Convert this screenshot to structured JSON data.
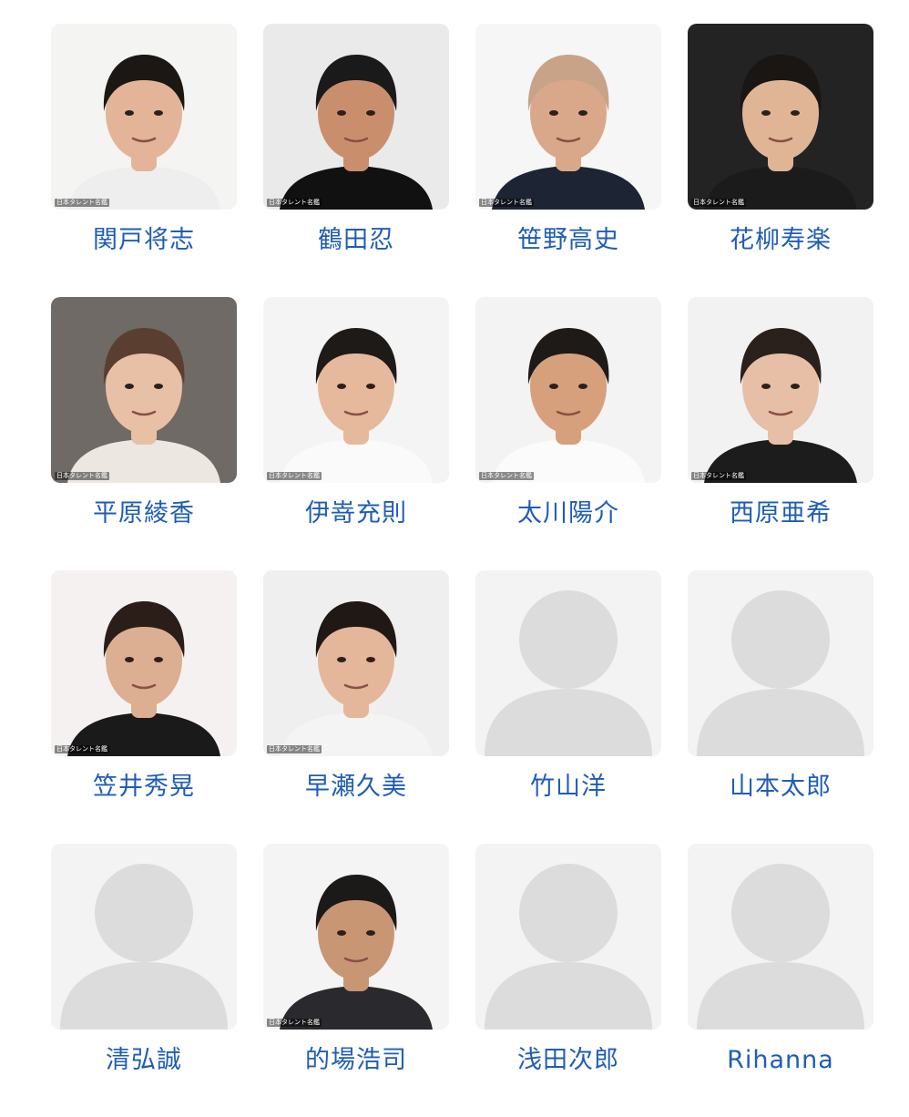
{
  "colors": {
    "name_link": "#1f5db5",
    "placeholder_bg": "#f3f3f3",
    "placeholder_figure": "#dcdcdc"
  },
  "cast": [
    {
      "name": "関戸将志",
      "photo": "portrait",
      "watermark": "日本タレント名鑑",
      "bg": "#f4f4f2",
      "hair": "#1b1715",
      "skin": "#e3b497",
      "shirt": "#eeeeee"
    },
    {
      "name": "鶴田忍",
      "photo": "portrait",
      "watermark": "日本タレント名鑑",
      "bg": "#eaeaea",
      "hair": "#1a1a1a",
      "skin": "#c98f6d",
      "shirt": "#111111"
    },
    {
      "name": "笹野高史",
      "photo": "portrait",
      "watermark": "日本タレント名鑑",
      "bg": "#f6f6f6",
      "hair": "#c9a387",
      "skin": "#d9a88a",
      "shirt": "#1d2433"
    },
    {
      "name": "花柳寿楽",
      "photo": "portrait",
      "watermark": "日本タレント名鑑",
      "bg": "#232323",
      "hair": "#1a1614",
      "skin": "#e0b596",
      "shirt": "#1b1b1b"
    },
    {
      "name": "平原綾香",
      "photo": "portrait",
      "watermark": "日本タレント名鑑",
      "bg": "#6f6a66",
      "hair": "#5a3f30",
      "skin": "#e8c0a6",
      "shirt": "#ece7e1"
    },
    {
      "name": "伊嵜充則",
      "photo": "portrait",
      "watermark": "日本タレント名鑑",
      "bg": "#f4f4f4",
      "hair": "#1d1a18",
      "skin": "#e6b99c",
      "shirt": "#fafafa"
    },
    {
      "name": "太川陽介",
      "photo": "portrait",
      "watermark": "日本タレント名鑑",
      "bg": "#f3f3f3",
      "hair": "#1e1a18",
      "skin": "#d7a07d",
      "shirt": "#fbfbfb"
    },
    {
      "name": "西原亜希",
      "photo": "portrait",
      "watermark": "日本タレント名鑑",
      "bg": "#f2f2f2",
      "hair": "#2a211c",
      "skin": "#e6bfa6",
      "shirt": "#1c1c1c"
    },
    {
      "name": "笠井秀晃",
      "photo": "portrait",
      "watermark": "日本タレント名鑑",
      "bg": "#f5f1f1",
      "hair": "#2b1d17",
      "skin": "#dcae92",
      "shirt": "#1a1a1a"
    },
    {
      "name": "早瀬久美",
      "photo": "portrait",
      "watermark": "日本タレント名鑑",
      "bg": "#efefef",
      "hair": "#1f1815",
      "skin": "#e4b69a",
      "shirt": "#f4f4f4"
    },
    {
      "name": "竹山洋",
      "photo": "placeholder",
      "watermark": "",
      "bg": "",
      "hair": "",
      "skin": "",
      "shirt": ""
    },
    {
      "name": "山本太郎",
      "photo": "placeholder",
      "watermark": "",
      "bg": "",
      "hair": "",
      "skin": "",
      "shirt": ""
    },
    {
      "name": "清弘誠",
      "photo": "placeholder",
      "watermark": "",
      "bg": "",
      "hair": "",
      "skin": "",
      "shirt": ""
    },
    {
      "name": "的場浩司",
      "photo": "portrait",
      "watermark": "日本タレント名鑑",
      "bg": "#f4f4f4",
      "hair": "#1c1a19",
      "skin": "#c99674",
      "shirt": "#2a2a2e"
    },
    {
      "name": "浅田次郎",
      "photo": "placeholder",
      "watermark": "",
      "bg": "",
      "hair": "",
      "skin": "",
      "shirt": ""
    },
    {
      "name": "Rihanna",
      "photo": "placeholder",
      "watermark": "",
      "bg": "",
      "hair": "",
      "skin": "",
      "shirt": ""
    }
  ]
}
